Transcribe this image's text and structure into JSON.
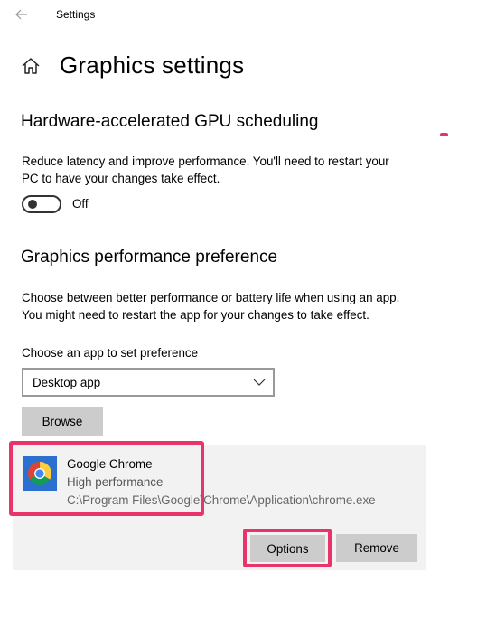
{
  "window": {
    "title": "Settings"
  },
  "page": {
    "title": "Graphics settings"
  },
  "gpu_scheduling": {
    "title": "Hardware-accelerated GPU scheduling",
    "description_line1": "Reduce latency and improve performance. You'll need to restart your",
    "description_line2": "PC to have your changes take effect.",
    "toggle_state": "Off"
  },
  "performance_preference": {
    "title": "Graphics performance preference",
    "description_line1": "Choose between better performance or battery life when using an app.",
    "description_line2": "You might need to restart the app for your changes to take effect.",
    "choose_label": "Choose an app to set preference",
    "dropdown_value": "Desktop app",
    "browse_label": "Browse"
  },
  "app_entry": {
    "name": "Google Chrome",
    "preference": "High performance",
    "path": "C:\\Program Files\\Google\\Chrome\\Application\\chrome.exe",
    "options_label": "Options",
    "remove_label": "Remove"
  },
  "colors": {
    "highlight": "#e8336b",
    "button_bg": "#cccccc",
    "card_bg": "#f2f2f2"
  },
  "icons": [
    "back-arrow-icon",
    "home-icon",
    "chevron-down-icon",
    "google-chrome-icon"
  ]
}
